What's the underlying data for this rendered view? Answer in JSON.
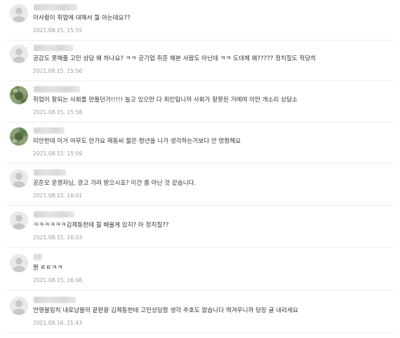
{
  "comments": [
    {
      "text": "이사람이 취업에 대해서 뭘 아는데요??",
      "date": "2021.08.15. 15:55",
      "avatar": "default-avatar"
    },
    {
      "text": "공감도 못해줄 고민 상담 왜 하나요? ㅋㅋ 공기업 취준 해본 사람도 아닌데 ㅋㅋ 도대체 왜????? 정치질도 적당히",
      "date": "2021.08.15. 15:56",
      "avatar": "default-avatar"
    },
    {
      "text": "취업이 잘되는 사회를 만들던가!!!!! 놀고 있으만 다 죄인입니까 사회가 잘못된 거에여 이딴 개소리 상담소",
      "date": "2021.08.15. 15:58",
      "avatar": "custom-avatar"
    },
    {
      "text": "미안한데 이거 아무도 안가요 재동씨 젊은 청년을 니가 생각하는거보다 안 멍청해요",
      "date": "2021.08.15. 15:59",
      "avatar": "custom-avatar"
    },
    {
      "text": "공준모 운영자님, 광고 가려 받으시죠? 이건 좀 아닌 것 같습니다.",
      "date": "2021.08.15. 16:01",
      "avatar": "default-avatar"
    },
    {
      "text": "ㅋㅋㅋㅋㅋㅋ김제동한테 뭘 배울게 있지? 아 정치질??",
      "date": "2021.08.15. 16:03",
      "avatar": "default-avatar"
    },
    {
      "text": "뭔 ㅌㅌㅋㅋ",
      "date": "2021.08.15. 16:06",
      "avatar": "default-avatar"
    },
    {
      "text": "언행불일치 내로남불의 끝판왕 김제동한테 고민상담할 생각 추호도 없습니다 역겨우니까 당장 글 내리세요",
      "date": "2021.08.16. 21:43",
      "avatar": "default-avatar"
    }
  ]
}
